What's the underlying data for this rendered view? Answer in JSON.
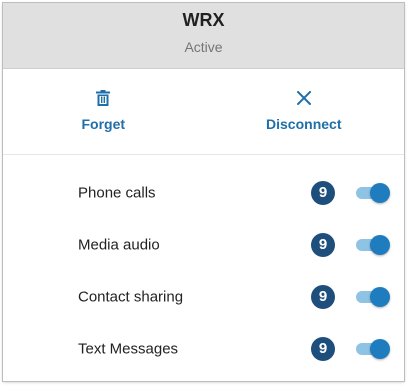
{
  "device": {
    "name": "WRX",
    "status": "Active"
  },
  "actions": {
    "forget": {
      "label": "Forget",
      "icon": "trash-icon"
    },
    "disconnect": {
      "label": "Disconnect",
      "icon": "close-icon"
    }
  },
  "settings": [
    {
      "label": "Phone calls",
      "badge": "9",
      "enabled": true
    },
    {
      "label": "Media audio",
      "badge": "9",
      "enabled": true
    },
    {
      "label": "Contact sharing",
      "badge": "9",
      "enabled": true
    },
    {
      "label": "Text Messages",
      "badge": "9",
      "enabled": true
    }
  ],
  "colors": {
    "accent": "#1f7cbf",
    "header_bg": "#e0e0e0",
    "badge_bg": "#1e4f7c",
    "track": "#8fc3e3"
  }
}
